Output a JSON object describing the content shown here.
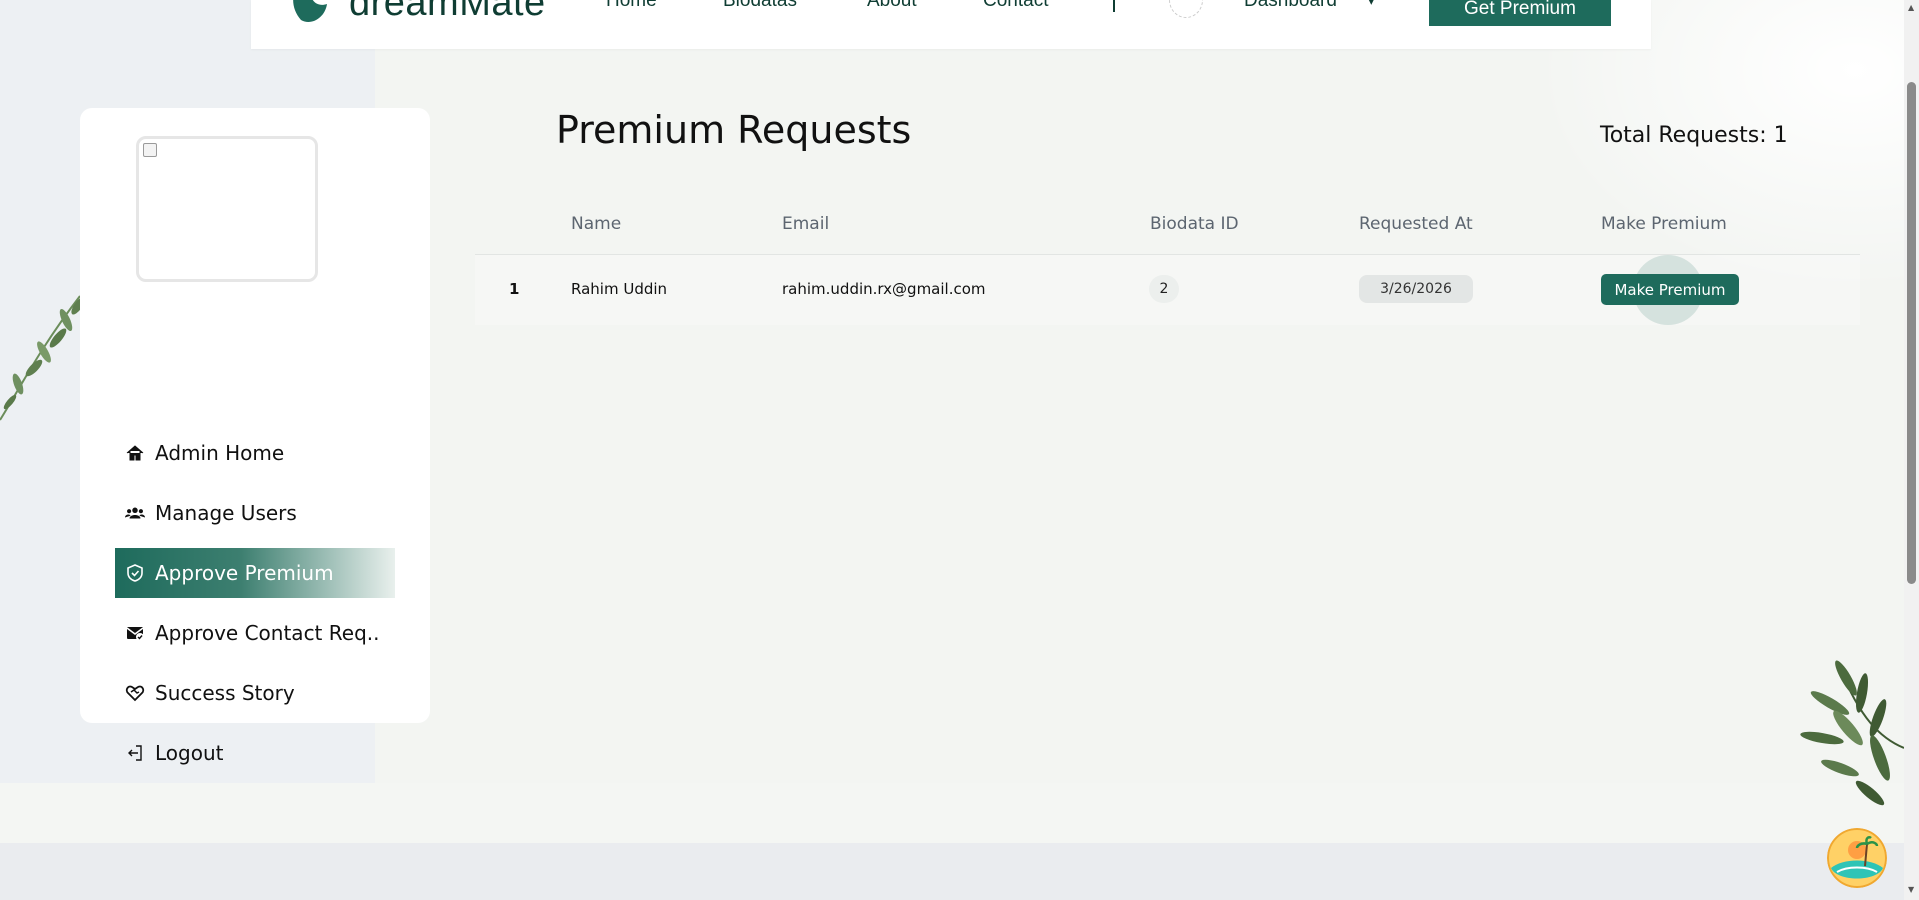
{
  "navbar": {
    "brand": "dreamMate",
    "links": [
      "Home",
      "Biodatas",
      "About",
      "Contact"
    ],
    "dashboard_label": "Dashboard",
    "get_premium_label": "Get Premium"
  },
  "sidebar": {
    "items": [
      {
        "label": "Admin Home",
        "icon": "home-icon",
        "active": false
      },
      {
        "label": "Manage Users",
        "icon": "users-icon",
        "active": false
      },
      {
        "label": "Approve Premium",
        "icon": "shield-check-icon",
        "active": true
      },
      {
        "label": "Approve Contact Req..",
        "icon": "mail-check-icon",
        "active": false
      },
      {
        "label": "Success Story",
        "icon": "heart-handshake-icon",
        "active": false
      },
      {
        "label": "Logout",
        "icon": "logout-icon",
        "active": false
      }
    ]
  },
  "main": {
    "title": "Premium Requests",
    "total_label": "Total Requests: 1",
    "table": {
      "headers": [
        "",
        "Name",
        "Email",
        "Biodata ID",
        "Requested At",
        "Make Premium"
      ],
      "rows": [
        {
          "index": "1",
          "name": "Rahim Uddin",
          "email": "rahim.uddin.rx@gmail.com",
          "biodata_id": "2",
          "requested_at": "3/26/2026",
          "action_label": "Make Premium"
        }
      ]
    }
  },
  "colors": {
    "primary": "#1e6b5c",
    "brand_dark": "#0f3d33",
    "page_bg": "#f4f6f3",
    "sidebar_bg": "#ffffff"
  }
}
